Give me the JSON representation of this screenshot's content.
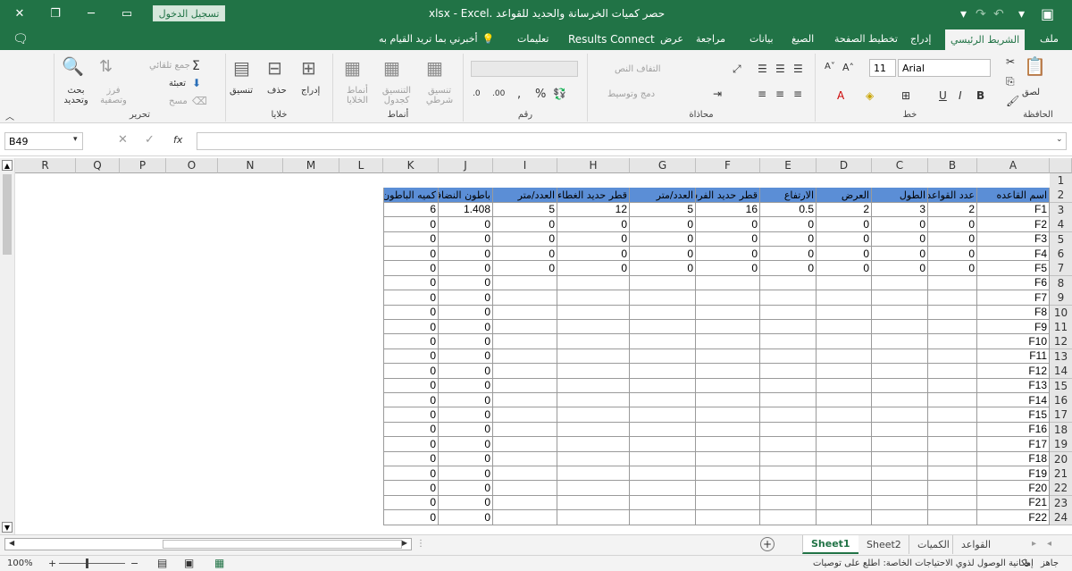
{
  "window": {
    "title": "حصر كميات الخرسانة والحديد للقواعد .xlsx  -  Excel",
    "login_label": "تسجيل الدخول"
  },
  "ribbon_tabs": [
    "ملف",
    "الشريط الرئيسي",
    "إدراج",
    "تخطيط الصفحة",
    "الصيغ",
    "بيانات",
    "مراجعة",
    "عرض",
    "Results Connect",
    "تعليمات",
    "أخبرني بما تريد القيام به"
  ],
  "ribbon": {
    "clipboard": {
      "label": "الحافظة",
      "paste": "لصق"
    },
    "font": {
      "label": "خط",
      "name": "Arial",
      "size": "11"
    },
    "alignment": {
      "label": "محاذاة",
      "wrap": "التفاف النص",
      "merge": "دمج وتوسيط"
    },
    "number": {
      "label": "رقم",
      "percent": "%",
      "comma": ","
    },
    "styles": {
      "label": "أنماط",
      "cond": "تنسيق شرطي",
      "table": "التنسيق كجدول",
      "cell": "أنماط الخلايا"
    },
    "cells": {
      "label": "خلايا",
      "insert": "إدراج",
      "delete": "حذف",
      "format": "تنسيق"
    },
    "editing": {
      "label": "تحرير",
      "autosum": "جمع تلقائي",
      "fill": "تعبئة",
      "clear": "مسح",
      "sort": "فرز وتصفية",
      "find": "بحث وتحديد"
    }
  },
  "name_box": "B49",
  "fx": "fx",
  "columns": [
    "A",
    "B",
    "C",
    "D",
    "E",
    "F",
    "G",
    "H",
    "I",
    "J",
    "K",
    "L",
    "M",
    "N",
    "O",
    "P",
    "Q",
    "R"
  ],
  "row_numbers": [
    "1",
    "2",
    "3",
    "4",
    "5",
    "6",
    "7",
    "8",
    "9",
    "10",
    "11",
    "12",
    "13",
    "14",
    "15",
    "16",
    "17",
    "18",
    "19",
    "20",
    "21",
    "22",
    "23",
    "24"
  ],
  "table": {
    "headers": [
      "اسم القاعده",
      "عدد القواعد",
      "الطول",
      "العرض",
      "الارتفاع",
      "قطر حديد الفرش",
      "العدد/متر",
      "قطر حديد الغطاء",
      "العدد/متر",
      "باطون النضافة",
      "كميه الباطون"
    ],
    "rows": [
      [
        "F1",
        "2",
        "3",
        "2",
        "0.5",
        "16",
        "5",
        "12",
        "5",
        "1.408",
        "6"
      ],
      [
        "F2",
        "0",
        "0",
        "0",
        "0",
        "0",
        "0",
        "0",
        "0",
        "0",
        "0"
      ],
      [
        "F3",
        "0",
        "0",
        "0",
        "0",
        "0",
        "0",
        "0",
        "0",
        "0",
        "0"
      ],
      [
        "F4",
        "0",
        "0",
        "0",
        "0",
        "0",
        "0",
        "0",
        "0",
        "0",
        "0"
      ],
      [
        "F5",
        "0",
        "0",
        "0",
        "0",
        "0",
        "0",
        "0",
        "0",
        "0",
        "0"
      ],
      [
        "F6",
        "",
        "",
        "",
        "",
        "",
        "",
        "",
        "",
        "0",
        "0"
      ],
      [
        "F7",
        "",
        "",
        "",
        "",
        "",
        "",
        "",
        "",
        "0",
        "0"
      ],
      [
        "F8",
        "",
        "",
        "",
        "",
        "",
        "",
        "",
        "",
        "0",
        "0"
      ],
      [
        "F9",
        "",
        "",
        "",
        "",
        "",
        "",
        "",
        "",
        "0",
        "0"
      ],
      [
        "F10",
        "",
        "",
        "",
        "",
        "",
        "",
        "",
        "",
        "0",
        "0"
      ],
      [
        "F11",
        "",
        "",
        "",
        "",
        "",
        "",
        "",
        "",
        "0",
        "0"
      ],
      [
        "F12",
        "",
        "",
        "",
        "",
        "",
        "",
        "",
        "",
        "0",
        "0"
      ],
      [
        "F13",
        "",
        "",
        "",
        "",
        "",
        "",
        "",
        "",
        "0",
        "0"
      ],
      [
        "F14",
        "",
        "",
        "",
        "",
        "",
        "",
        "",
        "",
        "0",
        "0"
      ],
      [
        "F15",
        "",
        "",
        "",
        "",
        "",
        "",
        "",
        "",
        "0",
        "0"
      ],
      [
        "F16",
        "",
        "",
        "",
        "",
        "",
        "",
        "",
        "",
        "0",
        "0"
      ],
      [
        "F17",
        "",
        "",
        "",
        "",
        "",
        "",
        "",
        "",
        "0",
        "0"
      ],
      [
        "F18",
        "",
        "",
        "",
        "",
        "",
        "",
        "",
        "",
        "0",
        "0"
      ],
      [
        "F19",
        "",
        "",
        "",
        "",
        "",
        "",
        "",
        "",
        "0",
        "0"
      ],
      [
        "F20",
        "",
        "",
        "",
        "",
        "",
        "",
        "",
        "",
        "0",
        "0"
      ],
      [
        "F21",
        "",
        "",
        "",
        "",
        "",
        "",
        "",
        "",
        "0",
        "0"
      ],
      [
        "F22",
        "",
        "",
        "",
        "",
        "",
        "",
        "",
        "",
        "0",
        "0"
      ]
    ]
  },
  "sheet_tabs": [
    "Sheet1",
    "Sheet2",
    "الكميات",
    "القواعد"
  ],
  "status": {
    "ready": "جاهز",
    "accessibility": "إمكانية الوصول لذوي الاحتياجات الخاصة: اطلع على توصيات",
    "zoom": "100%"
  }
}
